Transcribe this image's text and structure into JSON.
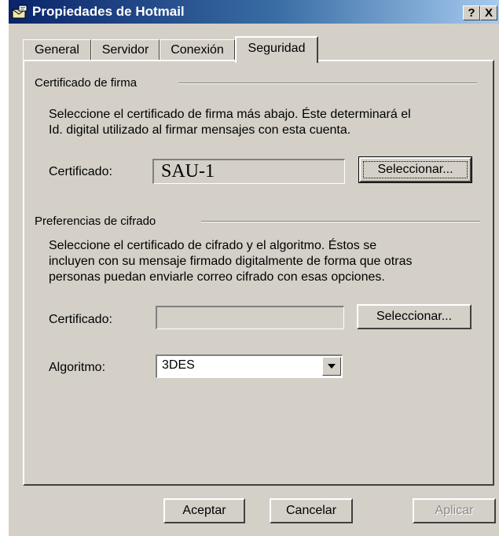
{
  "window": {
    "title": "Propiedades de Hotmail",
    "help_label": "?",
    "close_label": "X"
  },
  "tabs": [
    {
      "label": "General"
    },
    {
      "label": "Servidor"
    },
    {
      "label": "Conexión"
    },
    {
      "label": "Seguridad"
    }
  ],
  "signing": {
    "group_label": "Certificado de firma",
    "description_line1": "Seleccione el certificado de firma más abajo. Éste determinará el",
    "description_line2": "Id. digital utilizado al firmar mensajes con esta cuenta.",
    "cert_label": "Certificado:",
    "cert_value": "SAU-1",
    "select_label": "Seleccionar..."
  },
  "encryption": {
    "group_label": "Preferencias de cifrado",
    "description_line1": "Seleccione el certificado de cifrado y el algoritmo. Éstos se",
    "description_line2": "incluyen con su mensaje firmado digitalmente de forma que otras",
    "description_line3": "personas puedan enviarle correo cifrado con esas opciones.",
    "cert_label": "Certificado:",
    "cert_value": "",
    "select_label": "Seleccionar...",
    "algorithm_label": "Algoritmo:",
    "algorithm_value": "3DES"
  },
  "footer": {
    "ok_label": "Aceptar",
    "cancel_label": "Cancelar",
    "apply_label": "Aplicar"
  },
  "colors": {
    "face": "#d4d0c8",
    "title_start": "#0a246a",
    "title_end": "#a6caf0"
  }
}
